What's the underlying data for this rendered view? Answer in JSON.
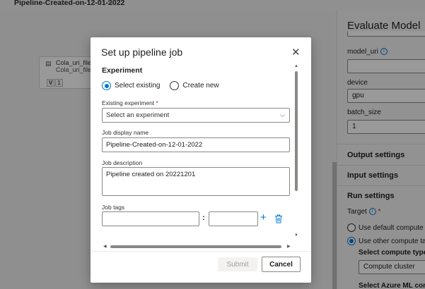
{
  "pipeline": {
    "title": "Pipeline-Created-on-12-01-2022"
  },
  "node": {
    "title": "Cola_uri_file",
    "subtitle": "Cola_uri_file",
    "badge_v": "V",
    "badge_num": "1"
  },
  "panel": {
    "title": "Evaluate Model",
    "model_uri_label": "model_uri",
    "device_label": "device",
    "device_value": "gpu",
    "batch_size_label": "batch_size",
    "batch_size_value": "1",
    "output_settings": "Output settings",
    "input_settings": "Input settings",
    "run_settings": "Run settings",
    "target_label": "Target",
    "default_compute": "Use default compute target",
    "other_compute": "Use other compute target",
    "select_compute_type": "Select compute type",
    "compute_type_value": "Compute cluster",
    "select_azure": "Select Azure ML compute"
  },
  "dialog": {
    "title": "Set up pipeline job",
    "experiment_section": "Experiment",
    "radio_existing": "Select existing",
    "radio_new": "Create new",
    "existing_experiment_label": "Existing experiment",
    "required_mark": "*",
    "select_placeholder": "Select an experiment",
    "job_display_name_label": "Job display name",
    "job_display_name_value": "Pipeline-Created-on-12-01-2022",
    "job_description_label": "Job description",
    "job_description_value": "Pipeline created on 20221201",
    "job_tags_label": "Job tags",
    "tag_separator": ":",
    "submit_label": "Submit",
    "cancel_label": "Cancel"
  },
  "colors": {
    "accent": "#0078d4",
    "required": "#a4262c",
    "disabled_text": "#a19f9d"
  }
}
